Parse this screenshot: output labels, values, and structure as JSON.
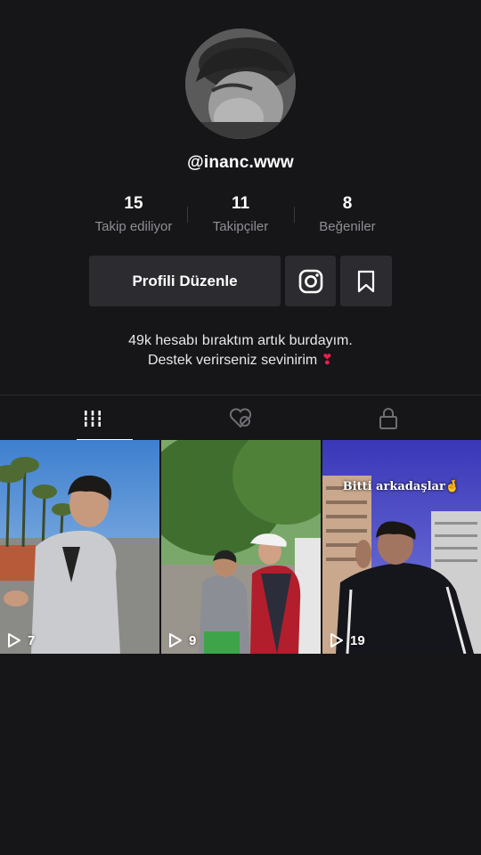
{
  "profile": {
    "username": "@inanc.www",
    "avatar_icon": "profile-photo"
  },
  "stats": [
    {
      "value": "15",
      "label": "Takip ediliyor"
    },
    {
      "value": "11",
      "label": "Takipçiler"
    },
    {
      "value": "8",
      "label": "Beğeniler"
    }
  ],
  "actions": {
    "edit_label": "Profili Düzenle",
    "instagram_icon": "instagram-icon",
    "bookmark_icon": "bookmark-icon"
  },
  "bio": {
    "line1": "49k hesabı bıraktım artık burdayım.",
    "line2": "Destek verirseniz sevinirim",
    "emoji": "❣"
  },
  "tabs": [
    {
      "icon": "videos-grid-icon",
      "active": true
    },
    {
      "icon": "liked-videos-icon",
      "active": false
    },
    {
      "icon": "lock-icon",
      "active": false
    }
  ],
  "videos": [
    {
      "views": "7",
      "caption": ""
    },
    {
      "views": "9",
      "caption": ""
    },
    {
      "views": "19",
      "caption": "Bitti arkadaşlar🤞"
    }
  ],
  "colors": {
    "background": "#161518",
    "button": "#2c2b2f",
    "muted_text": "#8f8e93",
    "accent_heart": "#ee1d52"
  }
}
